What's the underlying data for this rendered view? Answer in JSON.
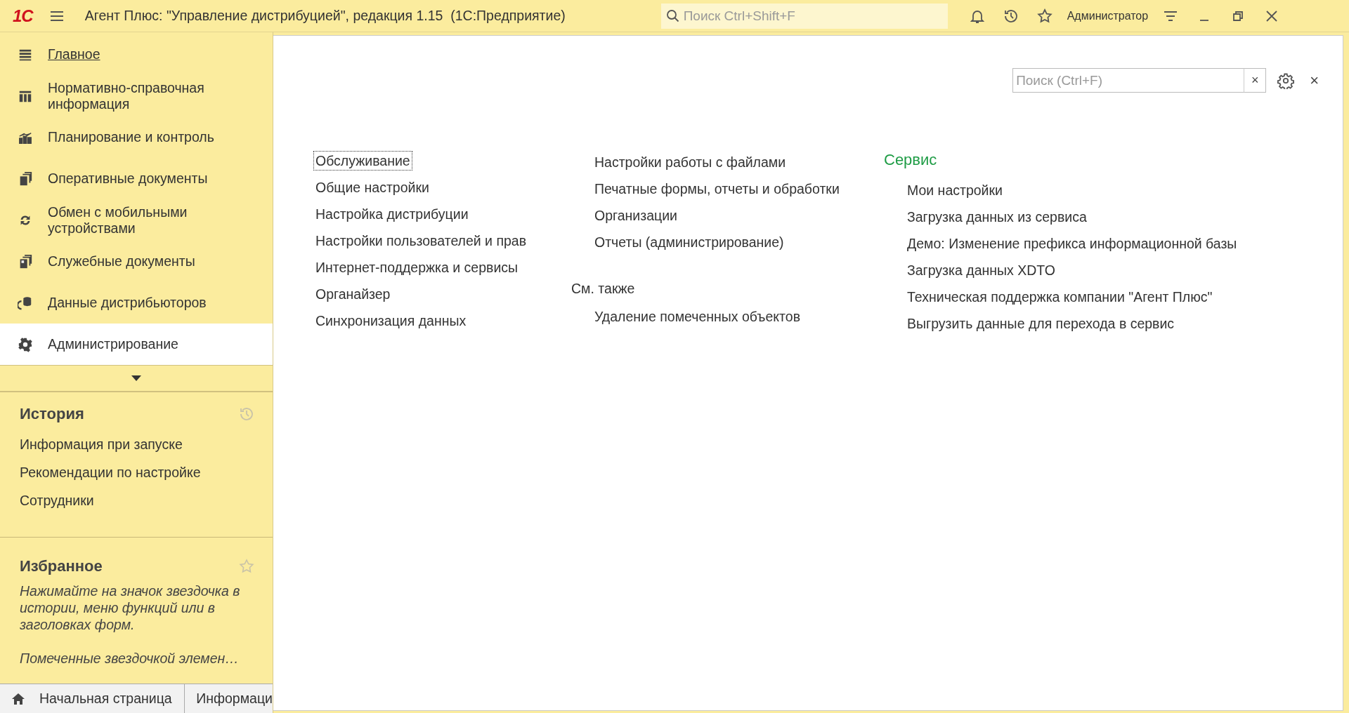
{
  "window": {
    "logo": "1С",
    "title": "Агент Плюс: \"Управление дистрибуцией\", редакция 1.15  (1С:Предприятие)",
    "search": {
      "placeholder": "Поиск Ctrl+Shift+F"
    },
    "user": "Администратор"
  },
  "sections": [
    {
      "label": "Главное",
      "selected": false,
      "underlined": true
    },
    {
      "label": "Нормативно-справочная информация",
      "selected": false,
      "underlined": false
    },
    {
      "label": "Планирование и контроль",
      "selected": false,
      "underlined": false
    },
    {
      "label": "Оперативные документы",
      "selected": false,
      "underlined": false
    },
    {
      "label": "Обмен с мобильными устройствами",
      "selected": false,
      "underlined": false
    },
    {
      "label": "Служебные документы",
      "selected": false,
      "underlined": false
    },
    {
      "label": "Данные дистрибьюторов",
      "selected": false,
      "underlined": false
    },
    {
      "label": "Администрирование",
      "selected": true,
      "underlined": false
    }
  ],
  "history": {
    "title": "История",
    "items": [
      "Информация при запуске",
      "Рекомендации по настройке",
      "Сотрудники"
    ]
  },
  "favorites": {
    "title": "Избранное",
    "hints": [
      "Нажимайте на значок звездочка в истории, меню функций или в заголовках форм.",
      "Помеченные звездочкой элемен…"
    ]
  },
  "open_tabs": [
    {
      "label": "Начальная страница",
      "kind": "home"
    },
    {
      "label": "Информаци",
      "kind": "page"
    }
  ],
  "panel": {
    "search": {
      "placeholder": "Поиск (Ctrl+F)"
    },
    "clear": "×",
    "close": "×",
    "column_1": [
      {
        "label": "Обслуживание",
        "focused": true
      },
      {
        "label": "Общие настройки",
        "focused": false
      },
      {
        "label": "Настройка дистрибуции",
        "focused": false
      },
      {
        "label": "Настройки пользователей и прав",
        "focused": false
      },
      {
        "label": "Интернет-поддержка и сервисы",
        "focused": false
      },
      {
        "label": "Органайзер",
        "focused": false
      },
      {
        "label": "Синхронизация данных",
        "focused": false
      }
    ],
    "column_2": {
      "items": [
        "Настройки работы с файлами",
        "Печатные формы, отчеты и обработки",
        "Организации",
        "Отчеты (администрирование)"
      ],
      "see_also": {
        "title": "См. также",
        "items": [
          "Удаление помеченных объектов"
        ]
      }
    },
    "column_3": {
      "title": "Сервис",
      "items": [
        "Мои настройки",
        "Загрузка данных из сервиса",
        "Демо: Изменение префикса информационной базы",
        "Загрузка данных XDTO",
        "Техническая поддержка компании \"Агент Плюс\"",
        "Выгрузить данные для перехода в сервис"
      ]
    }
  }
}
